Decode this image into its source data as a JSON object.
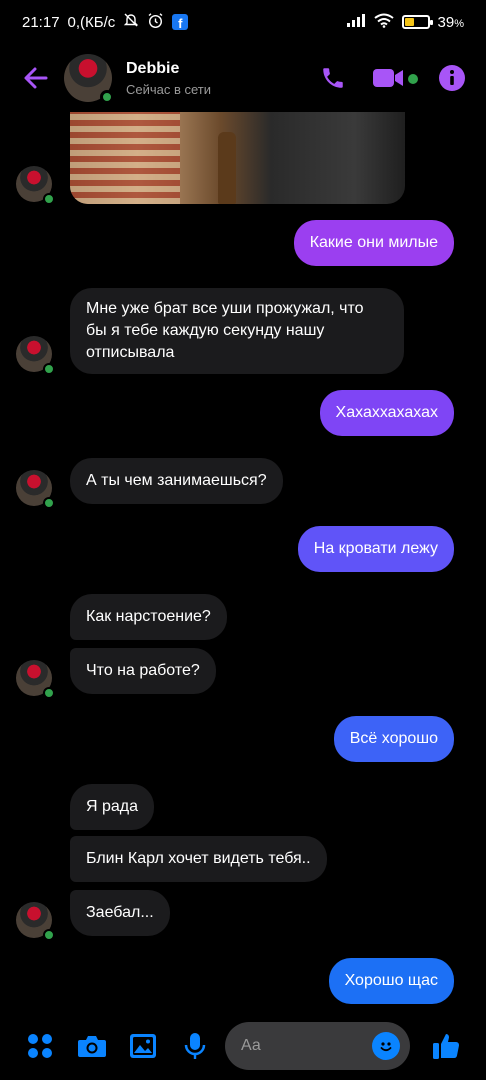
{
  "status_bar": {
    "time": "21:17",
    "speed": "0,(КБ/с",
    "battery": "39",
    "battery_suffix": "%",
    "battery_level": 0.39,
    "app_badge": "f"
  },
  "header": {
    "contact_name": "Debbie",
    "contact_status": "Сейчас в сети",
    "accent_color": "#a855f7"
  },
  "messages": [
    {
      "side": "in",
      "text": "Мне уже брат все уши прожужал, что бы я тебе каждую секунду нашу отписывала"
    },
    {
      "side": "out",
      "text": "Какие они милые",
      "color": "#9b3ff0"
    },
    {
      "side": "out",
      "text": "Хахаххахахах",
      "color": "#7f45f5"
    },
    {
      "side": "in",
      "text": "А ты чем занимаешься?"
    },
    {
      "side": "out",
      "text": "На кровати лежу",
      "color": "#6054f8"
    },
    {
      "side": "in",
      "text": "Как нарстоение?"
    },
    {
      "side": "in",
      "text": "Что на работе?"
    },
    {
      "side": "out",
      "text": "Всё хорошо",
      "color": "#3d63f7"
    },
    {
      "side": "in",
      "text": "Я рада"
    },
    {
      "side": "in",
      "text": "Блин Карл хочет видеть тебя.."
    },
    {
      "side": "in",
      "text": "Заебал..."
    },
    {
      "side": "out",
      "text": "Хорошо щас",
      "color": "#1c70f5"
    }
  ],
  "composer": {
    "placeholder": "Аа"
  }
}
